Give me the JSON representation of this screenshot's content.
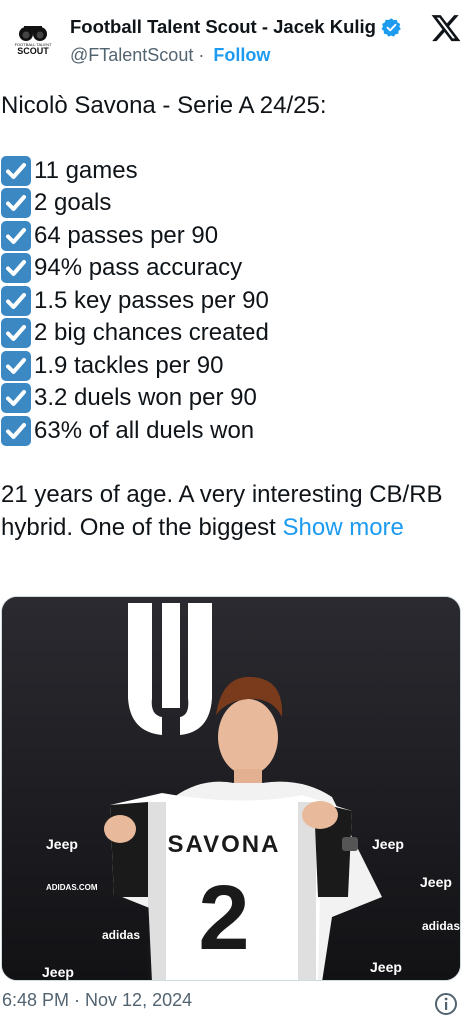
{
  "author": {
    "display_name": "Football Talent Scout - Jacek Kulig",
    "handle": "@FTalentScout",
    "separator": "·",
    "follow_label": "Follow",
    "avatar_text": "SCOUT",
    "avatar_small_text": "FOOTBALL TALENT"
  },
  "tweet": {
    "title": "Nicolò Savona - Serie A 24/25:",
    "stats": [
      "11 games",
      "2 goals",
      "64 passes per 90",
      "94% pass accuracy",
      "1.5 key passes per 90",
      "2 big chances created",
      "1.9 tackles per 90",
      "3.2 duels won per 90",
      "63% of all duels won"
    ],
    "body": "21 years of age. A very interesting CB/RB hybrid. One of the biggest ",
    "show_more": "Show more"
  },
  "media": {
    "shirt_name": "SAVONA",
    "shirt_number": "2",
    "sponsor": "Jeep",
    "sponsor2": "adidas",
    "sponsor3": "ADIDAS.COM"
  },
  "footer": {
    "timestamp": "6:48 PM · Nov 12, 2024"
  },
  "colors": {
    "accent": "#1d9bf0",
    "check": "#3b88c3",
    "secondary_text": "#536471"
  },
  "icons": {
    "verified": "verified-badge-icon",
    "platform": "x-logo-icon",
    "info": "info-icon",
    "check": "check-box-icon"
  }
}
